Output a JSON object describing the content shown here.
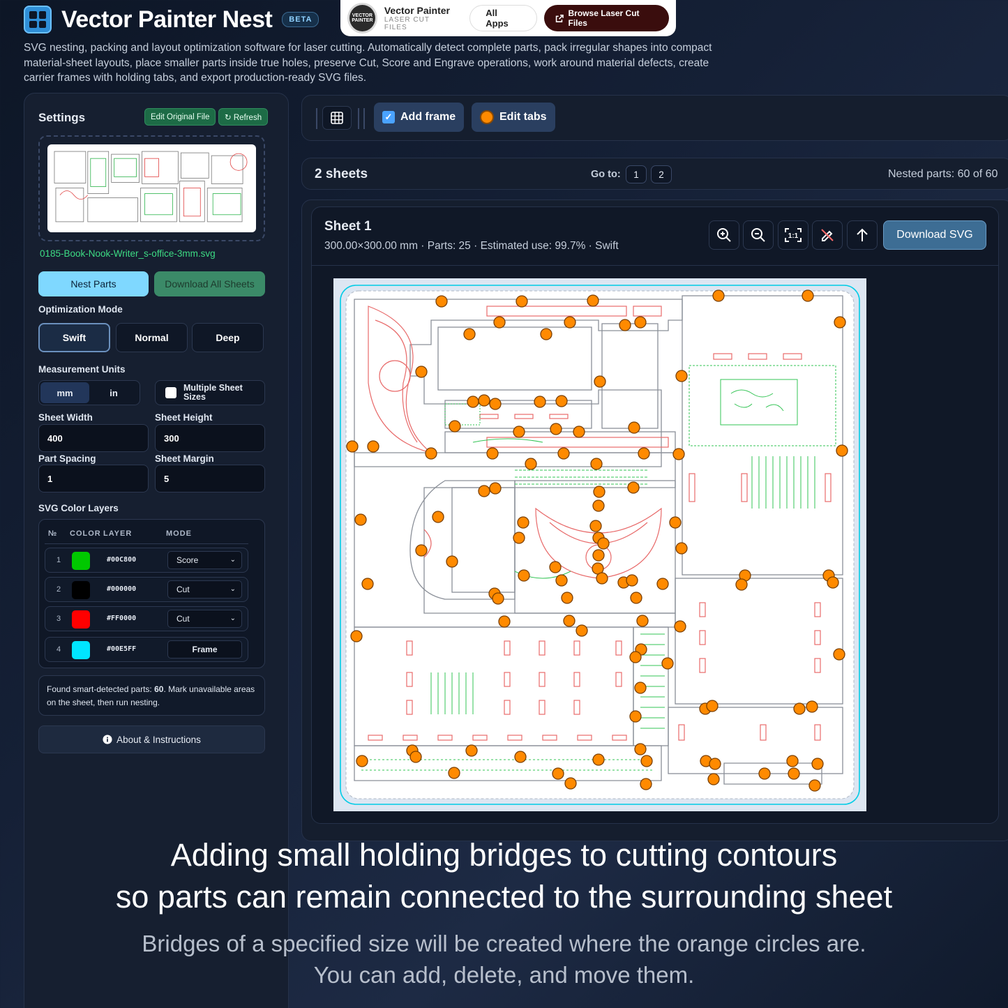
{
  "app": {
    "title": "Vector Painter Nest",
    "badge": "BETA",
    "description": "SVG nesting, packing and layout optimization software for laser cutting. Automatically detect complete parts, pack irregular shapes into compact material-sheet layouts, place smaller parts inside true holes, preserve Cut, Score and Engrave operations, work around material defects, create carrier frames with holding tabs, and export production-ready SVG files."
  },
  "brand": {
    "name": "Vector Painter",
    "sub": "LASER CUT FILES",
    "all_apps": "All Apps",
    "browse": "Browse Laser Cut Files",
    "browse_icon": "external-link-icon"
  },
  "sidebar": {
    "title": "Settings",
    "edit_original": "Edit Original File",
    "refresh": "↻ Refresh",
    "filename": "0185-Book-Nook-Writer_s-office-3mm.svg",
    "nest_parts": "Nest Parts",
    "download_all": "Download All Sheets",
    "optimization_label": "Optimization Mode",
    "modes": [
      "Swift",
      "Normal",
      "Deep"
    ],
    "active_mode": "Swift",
    "units_label": "Measurement Units",
    "units": [
      "mm",
      "in"
    ],
    "active_unit": "mm",
    "multi_sheet": "Multiple Sheet Sizes",
    "multi_sheet_checked": false,
    "sheet_width_label": "Sheet Width",
    "sheet_width": "400",
    "sheet_height_label": "Sheet Height",
    "sheet_height": "300",
    "part_spacing_label": "Part Spacing",
    "part_spacing": "1",
    "sheet_margin_label": "Sheet Margin",
    "sheet_margin": "5",
    "layers_label": "SVG Color Layers",
    "layers_head": {
      "num": "№",
      "color": "COLOR",
      "layer": "LAYER",
      "mode": "MODE"
    },
    "layers": [
      {
        "num": "1",
        "color": "#00C800",
        "hex": "#00C800",
        "mode": "Score"
      },
      {
        "num": "2",
        "color": "#000000",
        "hex": "#000000",
        "mode": "Cut"
      },
      {
        "num": "3",
        "color": "#FF0000",
        "hex": "#FF0000",
        "mode": "Cut"
      },
      {
        "num": "4",
        "color": "#00E5FF",
        "hex": "#00E5FF",
        "mode": "Frame"
      }
    ],
    "found_prefix": "Found smart-detected parts: ",
    "found_count": "60",
    "found_suffix": ". Mark unavailable areas on the sheet, then run nesting.",
    "about": "About & Instructions"
  },
  "toolbar": {
    "add_frame": "Add frame",
    "add_frame_checked": true,
    "edit_tabs": "Edit tabs"
  },
  "sheets": {
    "title": "2 sheets",
    "goto_label": "Go to:",
    "pages": [
      "1",
      "2"
    ],
    "nested": "Nested parts: 60 of 60"
  },
  "sheet": {
    "name": "Sheet 1",
    "meta": "300.00×300.00 mm · Parts: 25 · Estimated use: 99.7% · Swift",
    "download": "Download SVG",
    "icons": [
      "zoom-in-icon",
      "zoom-out-icon",
      "actual-size-icon",
      "no-edit-icon",
      "arrow-up-icon"
    ]
  },
  "caption": {
    "line1": "Adding small holding bridges to cutting contours",
    "line2": "so parts can remain connected to the surrounding sheet",
    "line3": "Bridges of a specified size will be created where the orange circles are.",
    "line4": "You can add, delete, and move them."
  },
  "colors": {
    "accent": "#7fd8ff",
    "bridge": "#ff8a00",
    "score": "#00C800",
    "cut_red": "#FF0000",
    "frame": "#00E5FF"
  }
}
